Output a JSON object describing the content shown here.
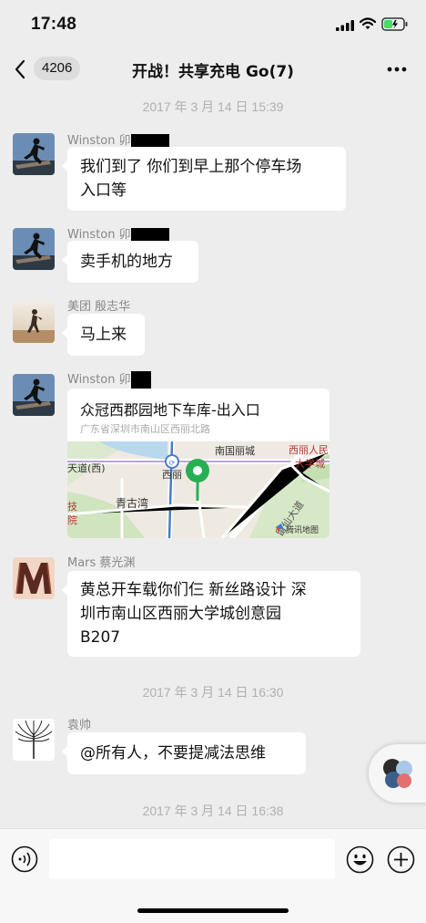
{
  "status_bar": {
    "time": "17:48"
  },
  "header": {
    "unread_count": "4206",
    "title": "开战！共享充电 Go(7)"
  },
  "timestamps": [
    "2017 年 3 月 14 日 15:39",
    "2017 年 3 月 14 日 16:30",
    "2017 年 3 月 14 日 16:38"
  ],
  "messages": [
    {
      "sender": "Winston 卯",
      "text_lines": [
        "我们到了 你们到早上那个停车场",
        "入口等"
      ]
    },
    {
      "sender": "Winston 卯",
      "text_lines": [
        "卖手机的地方"
      ]
    },
    {
      "sender": "美团 殷志华",
      "text_lines": [
        "马上来"
      ]
    },
    {
      "sender": "Winston 卯",
      "location": {
        "title": "众冠西郡园地下车库-出入口",
        "address": "广东省深圳市南山区西丽北路",
        "map_labels": [
          "南国丽城",
          "西丽人民",
          "大学城",
          "天道(西)",
          "西丽",
          "青古湾",
          "技",
          "院",
          "留仙大道",
          "腾讯地图"
        ]
      }
    },
    {
      "sender": "Mars 蔡光渊",
      "text_lines": [
        "黄总开车载你们仨  新丝路设计  深",
        "圳市南山区西丽大学城创意园",
        "B207"
      ]
    },
    {
      "sender": "袁帅",
      "text_lines": [
        "@所有人，不要提减法思维"
      ]
    }
  ],
  "colors": {
    "map_pin": "#27b053",
    "background": "#ededed",
    "bubble": "#ffffff",
    "timestamp": "#b0b0b0"
  },
  "icons": [
    "back-chevron-icon",
    "more-icon",
    "voice-icon",
    "emoji-icon",
    "plus-icon",
    "signal-icon",
    "wifi-icon",
    "battery-icon",
    "map-pin-icon"
  ]
}
